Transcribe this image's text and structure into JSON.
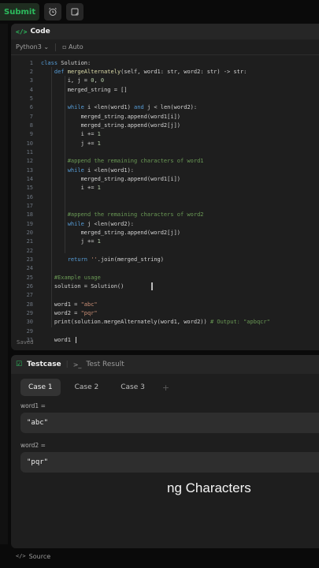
{
  "toolbar": {
    "submit_label": "Submit",
    "icons": [
      "alarm-clock-icon",
      "note-icon"
    ]
  },
  "editor": {
    "title": "Code",
    "language": "Python3",
    "mode": "Auto",
    "status": "Saved",
    "lines": [
      {
        "n": "1",
        "text": "class Solution:"
      },
      {
        "n": "2",
        "text": "    def mergeAlternately(self, word1: str, word2: str) -> str:"
      },
      {
        "n": "3",
        "text": "        i, j = 0, 0"
      },
      {
        "n": "4",
        "text": "        merged_string = []"
      },
      {
        "n": "5",
        "text": ""
      },
      {
        "n": "6",
        "text": "        while i <len(word1) and j < len(word2):"
      },
      {
        "n": "7",
        "text": "            merged_string.append(word1[i])"
      },
      {
        "n": "8",
        "text": "            merged_string.append(word2[j])"
      },
      {
        "n": "9",
        "text": "            i += 1"
      },
      {
        "n": "10",
        "text": "            j += 1"
      },
      {
        "n": "11",
        "text": ""
      },
      {
        "n": "12",
        "text": "        #append the remaining characters of word1"
      },
      {
        "n": "13",
        "text": "        while i <len(word1):"
      },
      {
        "n": "14",
        "text": "            merged_string.append(word1[i])"
      },
      {
        "n": "15",
        "text": "            i += 1"
      },
      {
        "n": "16",
        "text": ""
      },
      {
        "n": "17",
        "text": ""
      },
      {
        "n": "18",
        "text": "        #append the remaining characters of word2"
      },
      {
        "n": "19",
        "text": "        while j <len(word2):"
      },
      {
        "n": "20",
        "text": "            merged_string.append(word2[j])"
      },
      {
        "n": "21",
        "text": "            j += 1"
      },
      {
        "n": "22",
        "text": ""
      },
      {
        "n": "23",
        "text": "        return ''.join(merged_string)"
      },
      {
        "n": "24",
        "text": ""
      },
      {
        "n": "25",
        "text": "    #Example usage"
      },
      {
        "n": "26",
        "text": "    solution = Solution()"
      },
      {
        "n": "27",
        "text": ""
      },
      {
        "n": "28",
        "text": "    word1 = \"abc\""
      },
      {
        "n": "29",
        "text": "    word2 = \"pqr\""
      },
      {
        "n": "30",
        "text": "    print(solution.mergeAlternately(word1, word2)) # Output: \"apbqcr\""
      },
      {
        "n": "29",
        "text": ""
      },
      {
        "n": "31",
        "text": "    word1 "
      }
    ]
  },
  "testpanel": {
    "tab_active": "Testcase",
    "tab_other": "Test Result",
    "cases": [
      "Case 1",
      "Case 2",
      "Case 3"
    ],
    "add": "+",
    "vars": [
      {
        "name": "word1 =",
        "value": "\"abc\""
      },
      {
        "name": "word2 =",
        "value": "\"pqr\""
      }
    ]
  },
  "caption": "ng Characters",
  "source_label": "Source",
  "colors": {
    "keyword": "#569cd6",
    "function": "#dcdcaa",
    "comment": "#6a9955",
    "string": "#ce9178",
    "number": "#b5cea8",
    "accent_green": "#2cbb5d"
  }
}
